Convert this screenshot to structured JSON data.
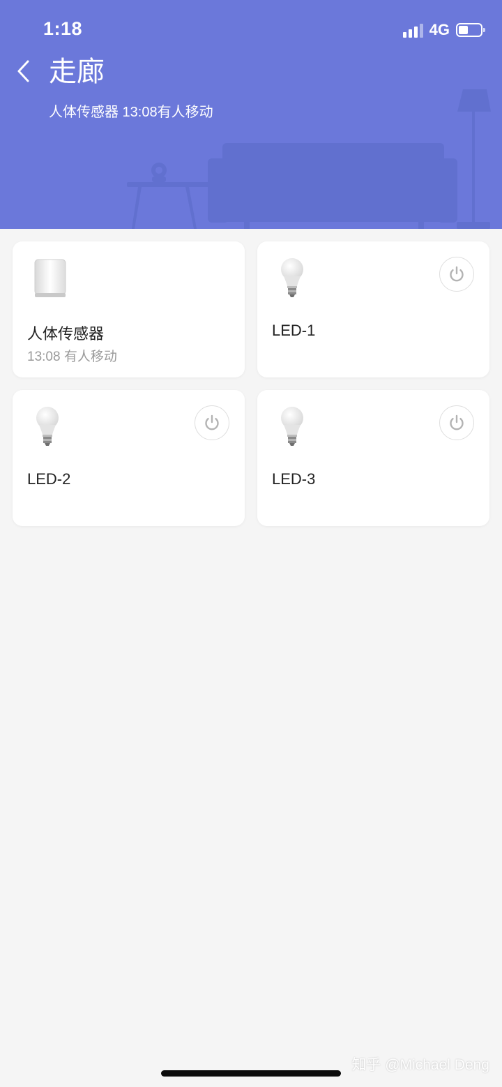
{
  "status_bar": {
    "time": "1:18",
    "network": "4G",
    "battery_level": 0.4,
    "signal_icon": "signal-bars-icon",
    "battery_icon": "battery-icon"
  },
  "header": {
    "title": "走廊",
    "subtitle": "人体传感器 13:08有人移动",
    "back_icon": "chevron-left-icon",
    "background_color": "#6b78da"
  },
  "devices": [
    {
      "name": "人体传感器",
      "status": "13:08 有人移动",
      "icon": "motion-sensor-icon",
      "has_power_button": false
    },
    {
      "name": "LED-1",
      "status": "",
      "icon": "light-bulb-icon",
      "has_power_button": true
    },
    {
      "name": "LED-2",
      "status": "",
      "icon": "light-bulb-icon",
      "has_power_button": true
    },
    {
      "name": "LED-3",
      "status": "",
      "icon": "light-bulb-icon",
      "has_power_button": true
    }
  ],
  "watermark": "知乎 @Michael Deng"
}
